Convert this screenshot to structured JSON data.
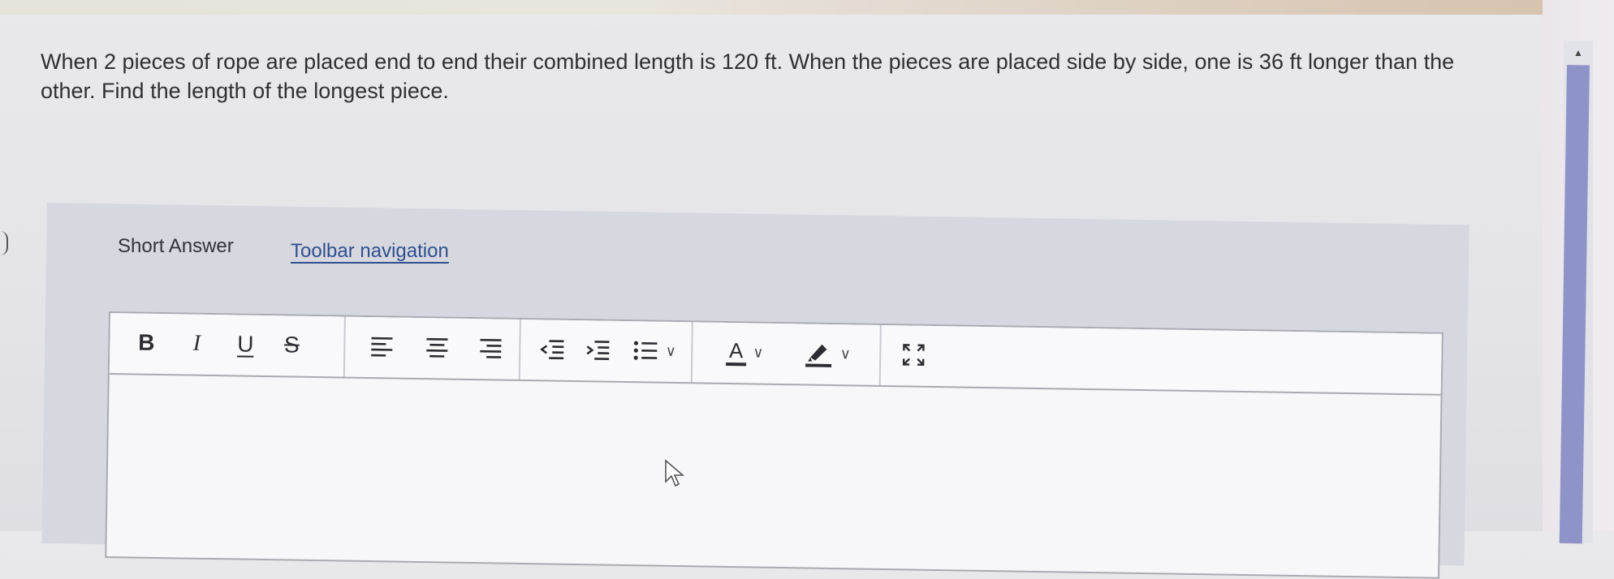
{
  "question": {
    "text": "When 2 pieces of rope are placed end to end their combined length is 120 ft. When the pieces are placed side by side, one is 36 ft longer than the other. Find the length of the longest piece."
  },
  "answer": {
    "type_label": "Short Answer",
    "toolbar_nav_label": "Toolbar navigation"
  },
  "toolbar": {
    "bold": "B",
    "italic": "I",
    "underline": "U",
    "strikethrough": "S",
    "font_color_label": "A",
    "icons": [
      "bold-icon",
      "italic-icon",
      "underline-icon",
      "strikethrough-icon",
      "align-left-icon",
      "align-center-icon",
      "align-right-icon",
      "outdent-icon",
      "indent-icon",
      "bullet-list-icon",
      "font-color-icon",
      "highlight-icon",
      "fullscreen-icon"
    ]
  },
  "editor": {
    "value": ""
  },
  "colors": {
    "link": "#2f4f8f",
    "panel": "#d6d7df",
    "scroll_thumb": "#8f94c8"
  }
}
